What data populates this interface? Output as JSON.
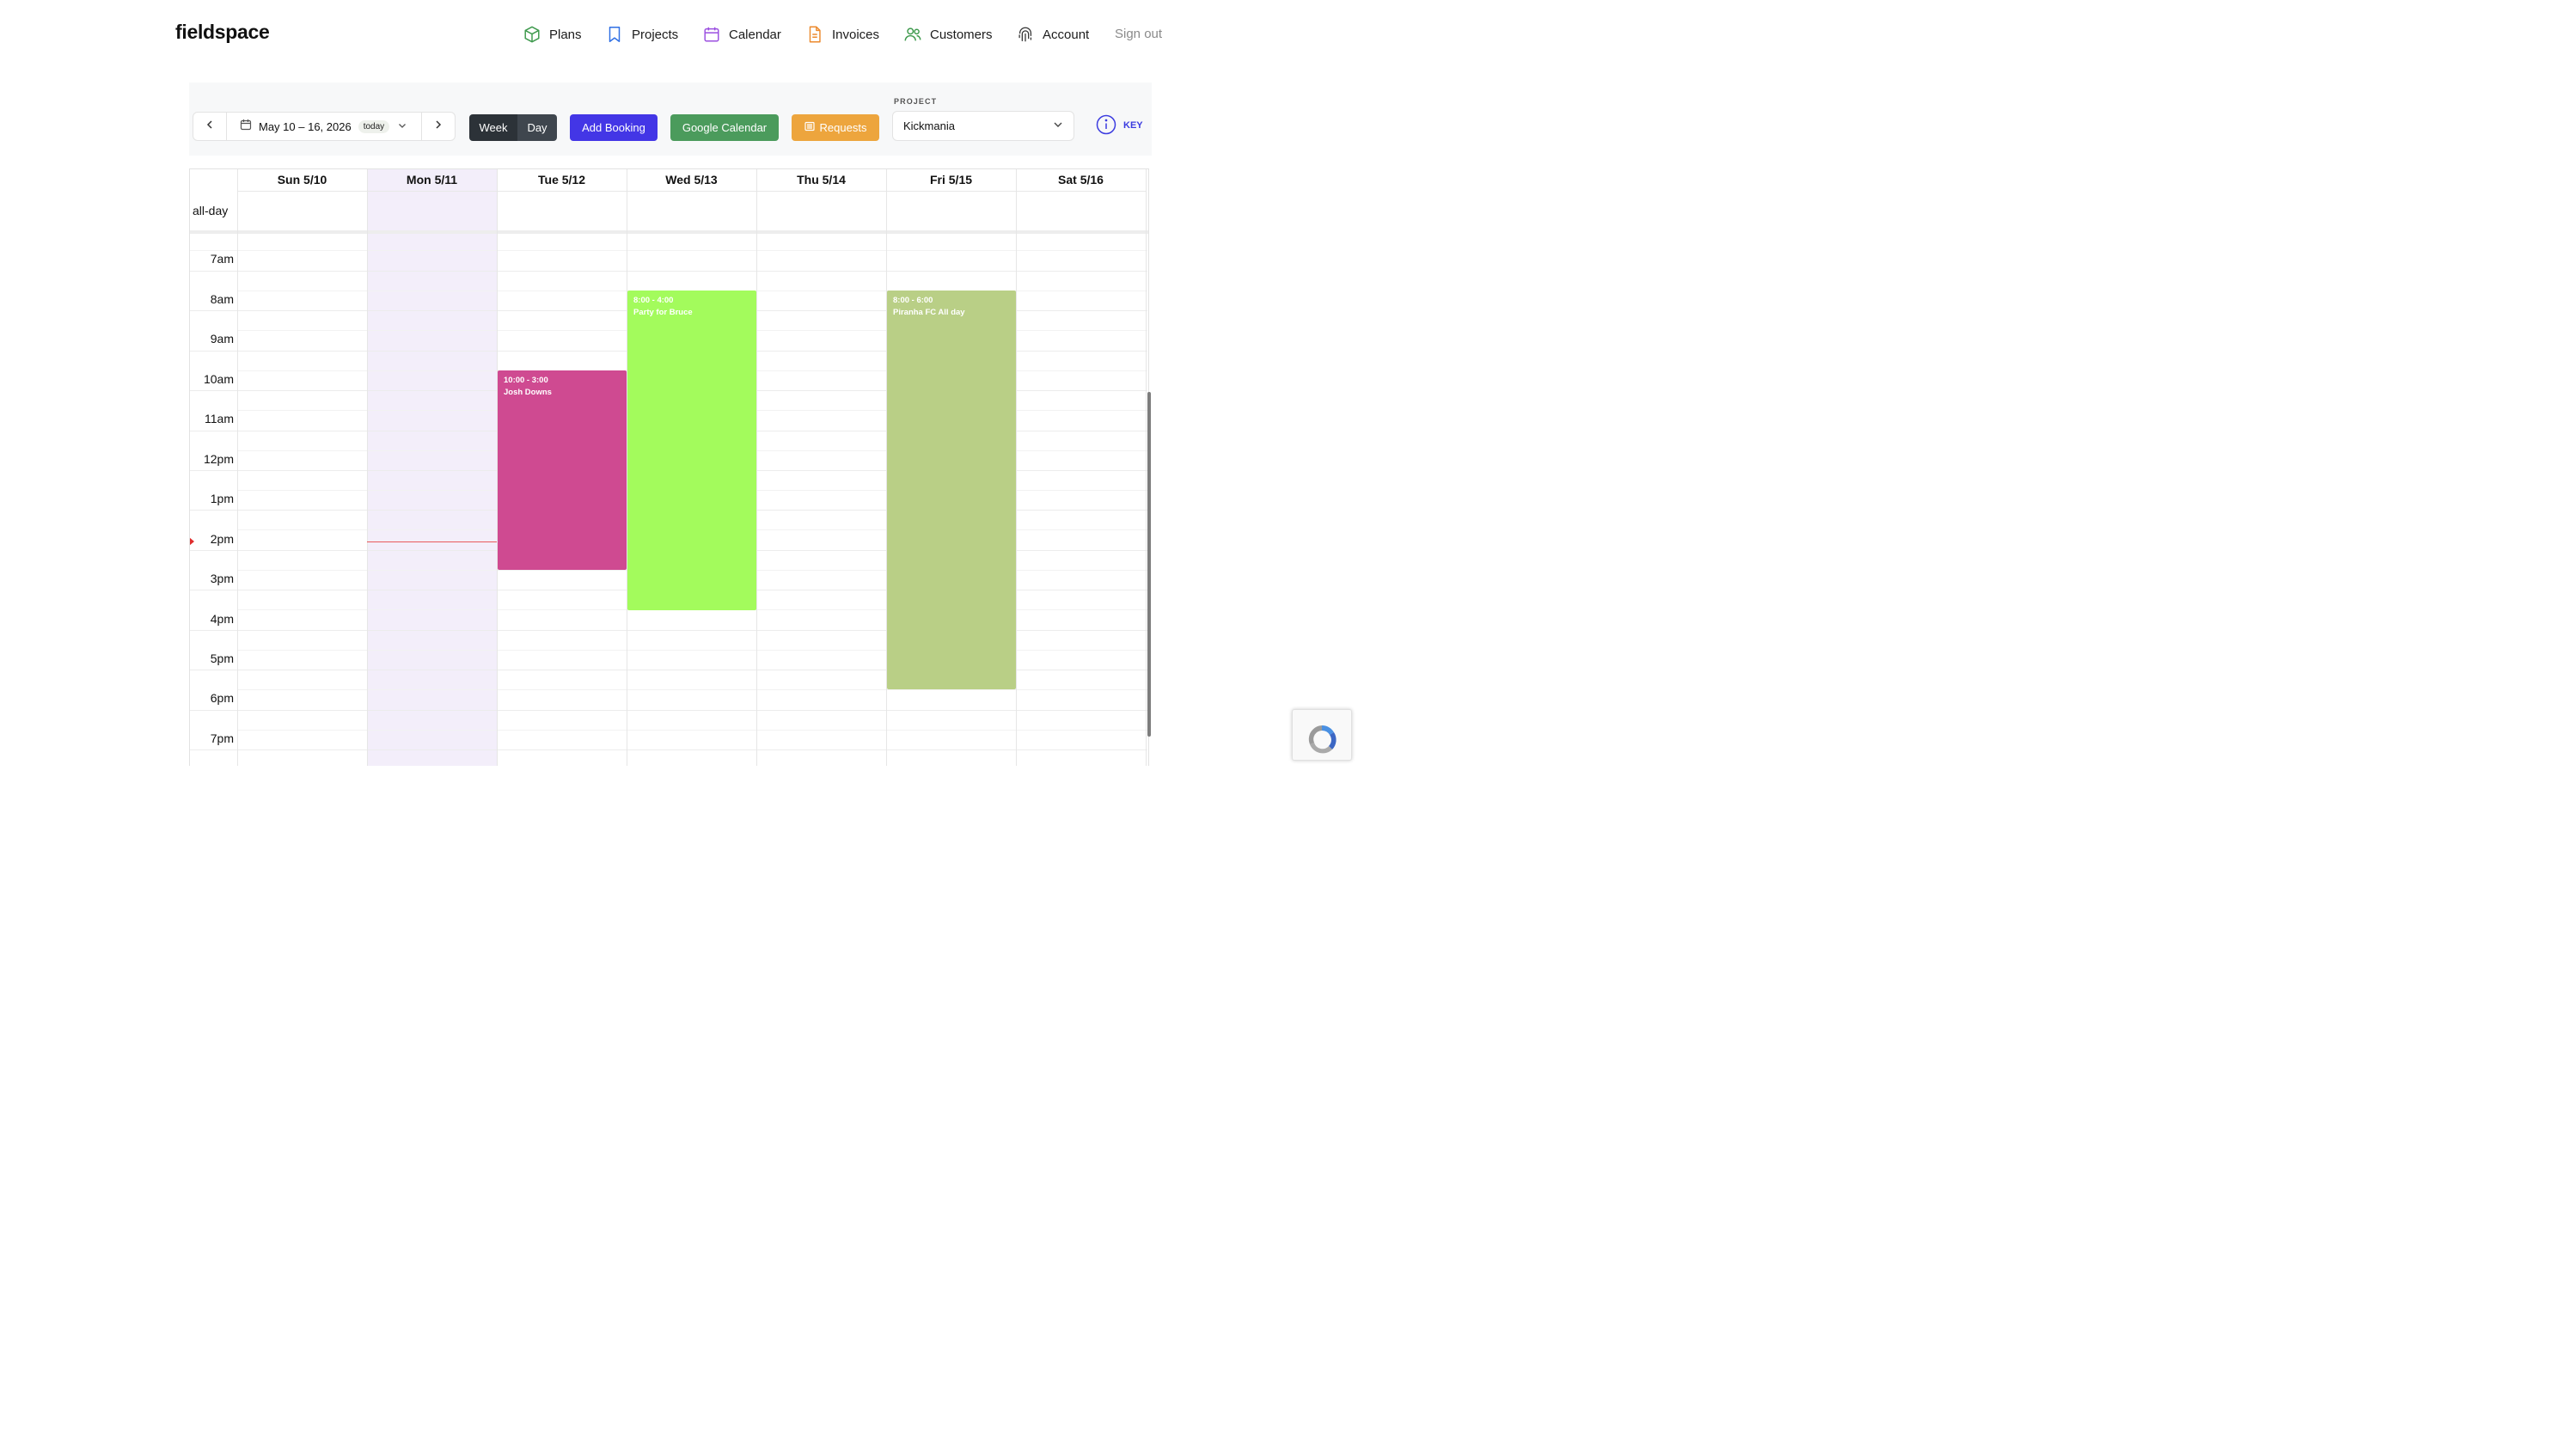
{
  "header": {
    "logo": "fieldspace",
    "nav": [
      {
        "label": "Plans",
        "icon": "cube-icon",
        "color": "#3f9a4e"
      },
      {
        "label": "Projects",
        "icon": "bookmark-icon",
        "color": "#2f6fe4"
      },
      {
        "label": "Calendar",
        "icon": "calendar-icon",
        "color": "#9b4fe0"
      },
      {
        "label": "Invoices",
        "icon": "document-icon",
        "color": "#ec8a2e"
      },
      {
        "label": "Customers",
        "icon": "users-icon",
        "color": "#3f9a4e"
      },
      {
        "label": "Account",
        "icon": "fingerprint-icon",
        "color": "#333333"
      }
    ],
    "sign_out": "Sign out"
  },
  "toolbar": {
    "date_range": "May 10 – 16, 2026",
    "today_badge": "today",
    "view_week": "Week",
    "view_day": "Day",
    "add_booking": "Add Booking",
    "google_calendar": "Google Calendar",
    "requests": "Requests",
    "project_label": "PROJECT",
    "project_value": "Kickmania",
    "key_label": "KEY"
  },
  "calendar": {
    "days": [
      "Sun 5/10",
      "Mon 5/11",
      "Tue 5/12",
      "Wed 5/13",
      "Thu 5/14",
      "Fri 5/15",
      "Sat 5/16"
    ],
    "highlighted_day": "Mon 5/11",
    "all_day_label": "all-day",
    "hours": [
      "7am",
      "8am",
      "9am",
      "10am",
      "11am",
      "12pm",
      "1pm",
      "2pm",
      "3pm",
      "4pm",
      "5pm",
      "6pm",
      "7pm"
    ],
    "events": [
      {
        "time": "10:00 - 3:00",
        "title": "Josh Downs",
        "day": "Tue 5/12",
        "color": "#cf4a91"
      },
      {
        "time": "8:00 - 4:00",
        "title": "Party for Bruce",
        "day": "Wed 5/13",
        "color": "#a3fb5c"
      },
      {
        "time": "8:00 - 6:00",
        "title": "Piranha FC All day",
        "day": "Fri 5/15",
        "color": "#b9cf86"
      }
    ],
    "current_time_color": "#e02d2d"
  }
}
